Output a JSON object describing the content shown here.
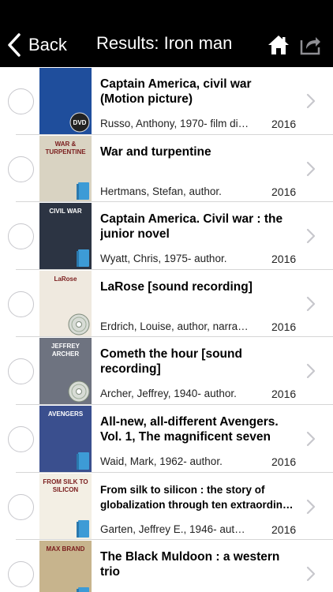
{
  "nav": {
    "back_label": "Back",
    "title": "Results: Iron man"
  },
  "results": [
    {
      "title": "Captain America, civil war (Motion picture)",
      "author": "Russo, Anthony, 1970- film di…",
      "year": "2016",
      "media": "dvd",
      "cover_color": "#1f4e9c",
      "cover_text": ""
    },
    {
      "title": "War and turpentine",
      "author": "Hertmans, Stefan, author.",
      "year": "2016",
      "media": "book",
      "cover_color": "#d9d3c2",
      "cover_text": "WAR & TURPENTINE"
    },
    {
      "title": "Captain America. Civil war : the junior novel",
      "author": "Wyatt, Chris, 1975- author.",
      "year": "2016",
      "media": "book",
      "cover_color": "#2c3443",
      "cover_text": "CIVIL WAR"
    },
    {
      "title": "LaRose [sound recording]",
      "author": "Erdrich, Louise, author, narra…",
      "year": "2016",
      "media": "audio",
      "cover_color": "#efe9df",
      "cover_text": "LaRose"
    },
    {
      "title": "Cometh the hour [sound recording]",
      "author": "Archer, Jeffrey, 1940- author.",
      "year": "2016",
      "media": "audio",
      "cover_color": "#6e7380",
      "cover_text": "JEFFREY ARCHER"
    },
    {
      "title": "All-new, all-different Avengers. Vol. 1, The magnificent seven",
      "author": "Waid, Mark, 1962- author.",
      "year": "2016",
      "media": "book",
      "cover_color": "#3a4f8e",
      "cover_text": "AVENGERS"
    },
    {
      "title": "From silk to silicon : the story of globalization through ten extraordin…",
      "author": "Garten, Jeffrey E., 1946- aut…",
      "year": "2016",
      "media": "book",
      "cover_color": "#f3efe4",
      "cover_text": "FROM SILK TO SILICON"
    },
    {
      "title": "The Black Muldoon : a western trio",
      "author": "",
      "year": "",
      "media": "book",
      "cover_color": "#c7b48d",
      "cover_text": "MAX BRAND"
    }
  ],
  "icons": {
    "back": "chevron-left-icon",
    "home": "home-icon",
    "share": "share-icon",
    "row_select": "radio-circle-icon",
    "row_disclosure": "chevron-right-icon",
    "book": "ebook-icon",
    "audio": "cd-icon",
    "dvd": "dvd-icon"
  },
  "colors": {
    "nav_background": "#000000",
    "nav_text": "#ffffff",
    "separator": "#d6d6d6",
    "chevron": "#c7c7cc",
    "ebook_badge": "#3d9bd6"
  }
}
